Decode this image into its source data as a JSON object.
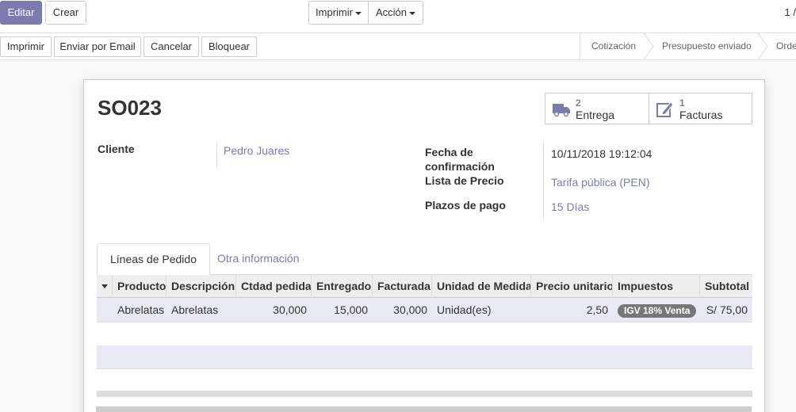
{
  "toolbar": {
    "edit_label": "Editar",
    "create_label": "Crear",
    "print_label": "Imprimir",
    "action_label": "Acción",
    "pager": "1 /"
  },
  "actions": {
    "print": "Imprimir",
    "email": "Enviar por Email",
    "cancel": "Cancelar",
    "lock": "Bloquear"
  },
  "statusbar": {
    "stages": [
      "Cotización",
      "Presupuesto enviado",
      "Orde"
    ]
  },
  "record": {
    "name": "SO023",
    "smart_buttons": [
      {
        "count": "2",
        "label": "Entrega",
        "icon": "truck-icon"
      },
      {
        "count": "1",
        "label": "Facturas",
        "icon": "edit-icon"
      }
    ],
    "customer_label": "Cliente",
    "customer": "Pedro Juares",
    "confirm_label_1": "Fecha de",
    "confirm_label_2": "confirmación",
    "confirm_date": "10/11/2018 19:12:04",
    "pricelist_label": "Lista de Precio",
    "pricelist": "Tarifa pública (PEN)",
    "terms_label": "Plazos de pago",
    "terms": "15 Días"
  },
  "tabs": [
    {
      "label": "Líneas de Pedido",
      "active": true
    },
    {
      "label": "Otra información",
      "active": false
    }
  ],
  "table": {
    "columns": [
      "Producto",
      "Descripción",
      "Ctdad pedida",
      "Entregado",
      "Facturada",
      "Unidad de Medida",
      "Precio unitario",
      "Impuestos",
      "Subtotal"
    ],
    "rows": [
      {
        "product": "Abrelatas",
        "description": "Abrelatas",
        "ordered": "30,000",
        "delivered": "15,000",
        "invoiced": "30,000",
        "uom": "Unidad(es)",
        "price": "2,50",
        "tax": "IGV 18% Venta",
        "subtotal": "S/ 75,00"
      }
    ]
  },
  "colors": {
    "accent": "#7c7bad",
    "row_highlight": "#e9e9f4"
  }
}
